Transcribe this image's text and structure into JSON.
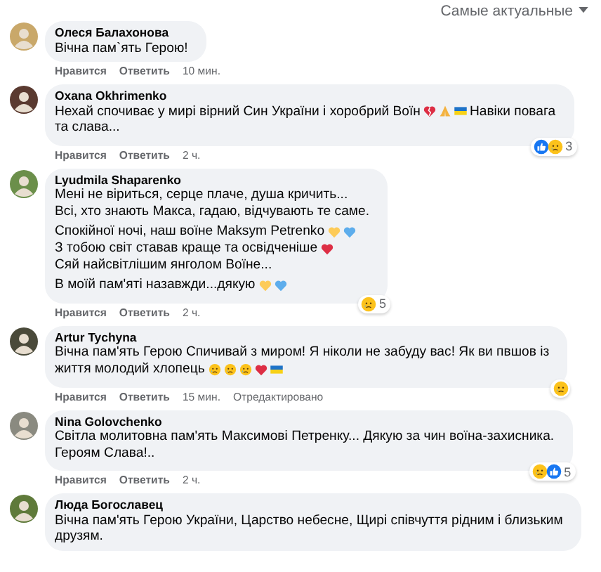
{
  "sort": {
    "label": "Самые актуальные"
  },
  "comments": [
    {
      "author": "Олеся Балахонова",
      "paragraphs": [
        [
          [
            {
              "kind": "text",
              "text": "Вічна пам`ять Герою!"
            }
          ]
        ]
      ],
      "actions": {
        "like": "Нравится",
        "reply": "Ответить",
        "time": "10 мин."
      }
    },
    {
      "author": "Oxana Okhrimenko",
      "paragraphs": [
        [
          [
            {
              "kind": "text",
              "text": "Нехай спочиває у мирі вірний Син України і хоробрий Воїн"
            },
            {
              "kind": "broken-heart"
            },
            {
              "kind": "pray"
            },
            {
              "kind": "flag"
            },
            {
              "kind": "text",
              "text": "Навіки повага"
            }
          ],
          [
            {
              "kind": "text",
              "text": "та слава..."
            }
          ]
        ]
      ],
      "actions": {
        "like": "Нравится",
        "reply": "Ответить",
        "time": "2 ч."
      },
      "reactions": {
        "icons": [
          {
            "kind": "like"
          },
          {
            "kind": "sad"
          }
        ],
        "count": "3"
      }
    },
    {
      "author": "Lyudmila Shaparenko",
      "paragraphs": [
        [
          [
            {
              "kind": "text",
              "text": "Мені не віриться, серце плаче, душа кричить..."
            }
          ],
          [
            {
              "kind": "text",
              "text": "Всі, хто знають Макса, гадаю, відчувають те саме."
            }
          ]
        ],
        [
          [
            {
              "kind": "text",
              "text": "Спокійної ночі, наш воїне Maksym Petrenko"
            },
            {
              "kind": "yellow-heart"
            },
            {
              "kind": "blue-heart"
            }
          ],
          [
            {
              "kind": "text",
              "text": "З тобою світ ставав краще та освідченіше"
            },
            {
              "kind": "red-heart"
            }
          ],
          [
            {
              "kind": "text",
              "text": "Сяй найсвітлішим янголом Воїне..."
            }
          ]
        ],
        [
          [
            {
              "kind": "text",
              "text": "В моїй пам'яті назавжди...дякую"
            },
            {
              "kind": "yellow-heart"
            },
            {
              "kind": "blue-heart"
            }
          ]
        ]
      ],
      "actions": {
        "like": "Нравится",
        "reply": "Ответить",
        "time": "2 ч."
      },
      "reactions": {
        "icons": [
          {
            "kind": "sad"
          }
        ],
        "count": "5"
      }
    },
    {
      "author": "Artur Tychyna",
      "paragraphs": [
        [
          [
            {
              "kind": "text",
              "text": "Вічна пам'ять Герою Спичивай з миром! Я ніколи не забуду вас! Як ви пвшов із"
            }
          ],
          [
            {
              "kind": "text",
              "text": "життя молодий хлопець"
            },
            {
              "kind": "sad"
            },
            {
              "kind": "sad"
            },
            {
              "kind": "sad"
            },
            {
              "kind": "red-heart"
            },
            {
              "kind": "flag"
            }
          ]
        ]
      ],
      "actions": {
        "like": "Нравится",
        "reply": "Ответить",
        "time": "15 мин.",
        "edited": "Отредактировано"
      },
      "reactions": {
        "icons": [
          {
            "kind": "sad"
          }
        ]
      }
    },
    {
      "author": "Nina Golovchenko",
      "paragraphs": [
        [
          [
            {
              "kind": "text",
              "text": "Світла молитовна пам'ять Максимові Петренку... Дякую за чин воїна-захисника."
            }
          ],
          [
            {
              "kind": "text",
              "text": "Героям Слава!.."
            }
          ]
        ]
      ],
      "actions": {
        "like": "Нравится",
        "reply": "Ответить",
        "time": "2 ч."
      },
      "reactions": {
        "icons": [
          {
            "kind": "sad"
          },
          {
            "kind": "like"
          }
        ],
        "count": "5"
      }
    },
    {
      "author": "Люда Богославец",
      "paragraphs": [
        [
          [
            {
              "kind": "text",
              "text": "Вічна пам'ять Герою України, Царство небесне, Щирі співчуття рідним і близьким"
            }
          ],
          [
            {
              "kind": "text",
              "text": "друзям."
            }
          ]
        ]
      ]
    }
  ]
}
